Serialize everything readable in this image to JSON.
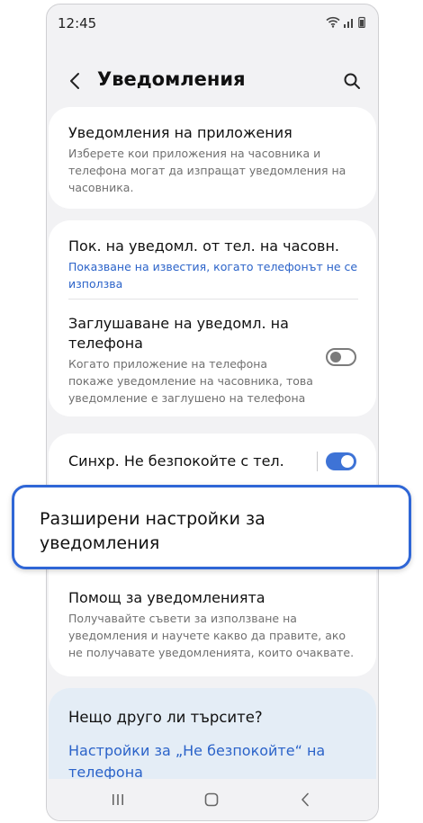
{
  "status_bar": {
    "time": "12:45"
  },
  "header": {
    "title": "Уведомления"
  },
  "cards": {
    "app_notifications": {
      "title": "Уведомления на приложения",
      "description": "Изберете кои приложения на часовника и телефона могат да изпращат уведомления на часовника."
    },
    "show_phone_notifications": {
      "title": "Пок. на уведомл. от тел. на часовн.",
      "value": "Показване на известия, когато телефонът не се използва"
    },
    "mute_phone_notifications": {
      "title": "Заглушаване на уведомл. на телефона",
      "description": "Когато приложение на телефона покаже уведомление на часовника, това уведомление е заглушено на телефона",
      "enabled": false
    },
    "sync_dnd": {
      "title": "Синхр. Не безпокойте с тел.",
      "enabled": true
    },
    "notification_help": {
      "title": "Помощ за уведомленията",
      "description": "Получавайте съвети за използване на уведомления и научете какво да правите, ако не получавате уведомленията, които очаквате."
    },
    "looking_for": {
      "title": "Нещо друго ли търсите?",
      "link": "Настройки за „Не безпокойте“ на телефона"
    }
  },
  "highlight": {
    "label": "Разширени настройки за уведомления",
    "accent_color": "#2f66d6"
  },
  "nav_bar": {
    "icons": [
      "recents-icon",
      "home-icon",
      "back-icon"
    ]
  },
  "colors": {
    "toggle_on": "#3e73d6",
    "link": "#2b63c9"
  }
}
